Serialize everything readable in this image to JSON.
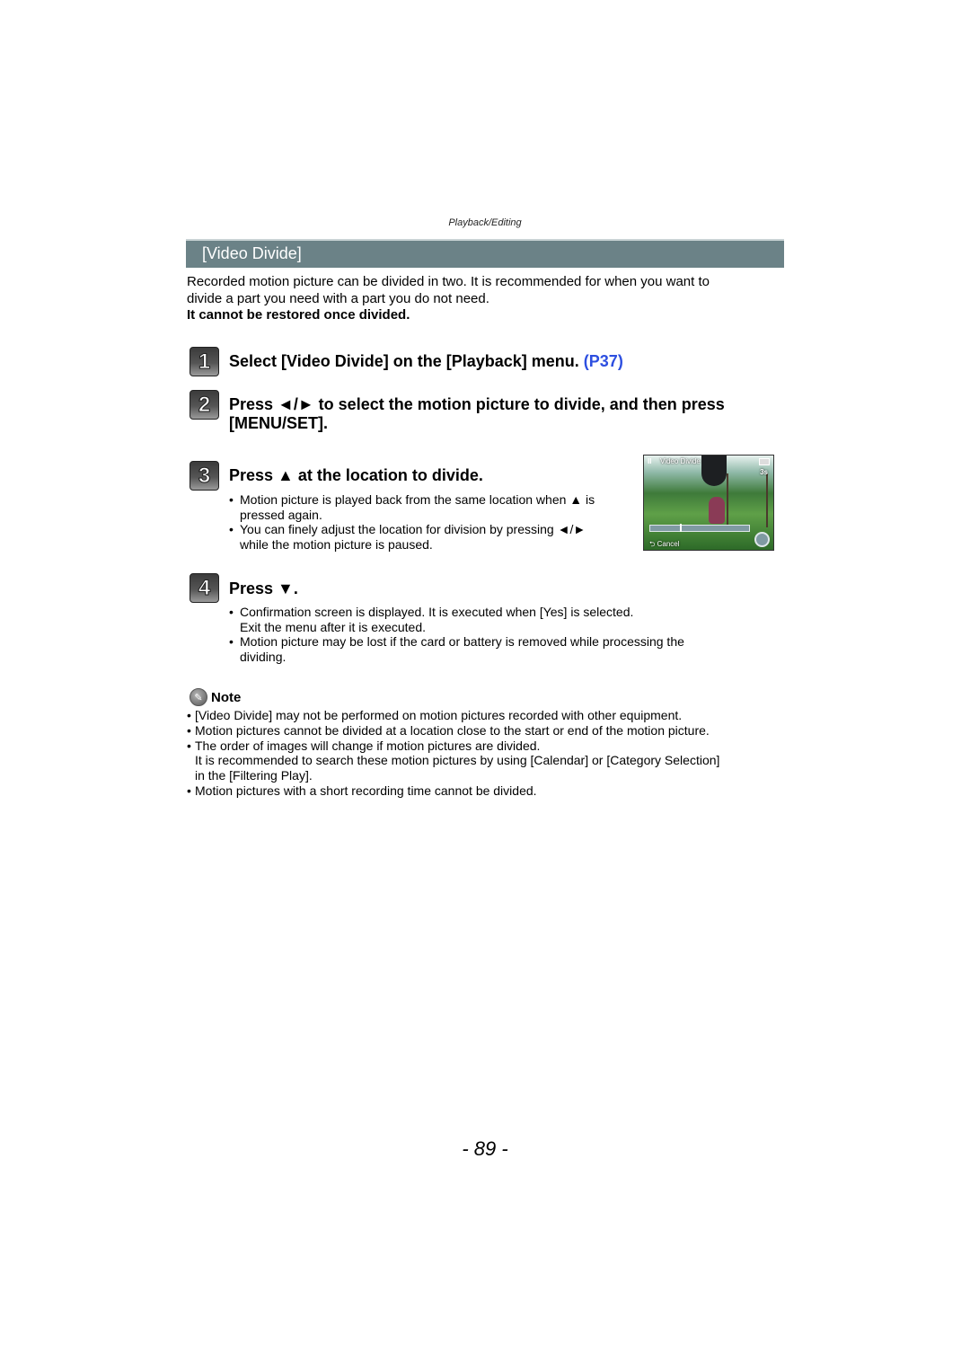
{
  "running_head": "Playback/Editing",
  "section_title": "[Video Divide]",
  "intro": {
    "line1": "Recorded motion picture can be divided in two. It is recommended for when you want to",
    "line2": "divide a part you need with a part you do not need.",
    "warning": "It cannot be restored once divided."
  },
  "steps": [
    {
      "number": "1",
      "title": "Select [Video Divide] on the [Playback] menu.",
      "link": "(P37)"
    },
    {
      "number": "2",
      "title_line1": "Press ◄/► to select the motion picture to divide, and then press",
      "title_line2": "[MENU/SET]."
    },
    {
      "number": "3",
      "title": "Press ▲ at the location to divide.",
      "bullets": [
        {
          "line1": "Motion picture is played back from the same location when ▲ is",
          "line2": "pressed again."
        },
        {
          "line1": "You can finely adjust the location for division by pressing ◄/►",
          "line2": "while the motion picture is paused."
        }
      ]
    },
    {
      "number": "4",
      "title": "Press ▼.",
      "bullets": [
        {
          "line1": "Confirmation screen is displayed. It is executed when [Yes] is selected.",
          "line2": "Exit the menu after it is executed."
        },
        {
          "line1": "Motion picture may be lost if the card or battery is removed while processing the",
          "line2": "dividing."
        }
      ]
    }
  ],
  "screen_preview": {
    "title": "Video Divide",
    "pause_icon": "II",
    "seconds": "3s",
    "cancel_label": "⮌ Cancel"
  },
  "note": {
    "label": "Note",
    "items": [
      {
        "line1": "[Video Divide] may not be performed on motion pictures recorded with other equipment."
      },
      {
        "line1": "Motion pictures cannot be divided at a location close to the start or end of the motion picture."
      },
      {
        "line1": "The order of images will change if motion pictures are divided.",
        "line2": "It is recommended to search these motion pictures by using [Calendar] or [Category Selection]",
        "line3": "in the [Filtering Play]."
      },
      {
        "line1": "Motion pictures with a short recording time cannot be divided."
      }
    ]
  },
  "page_number": "- 89 -",
  "bullet": "•"
}
